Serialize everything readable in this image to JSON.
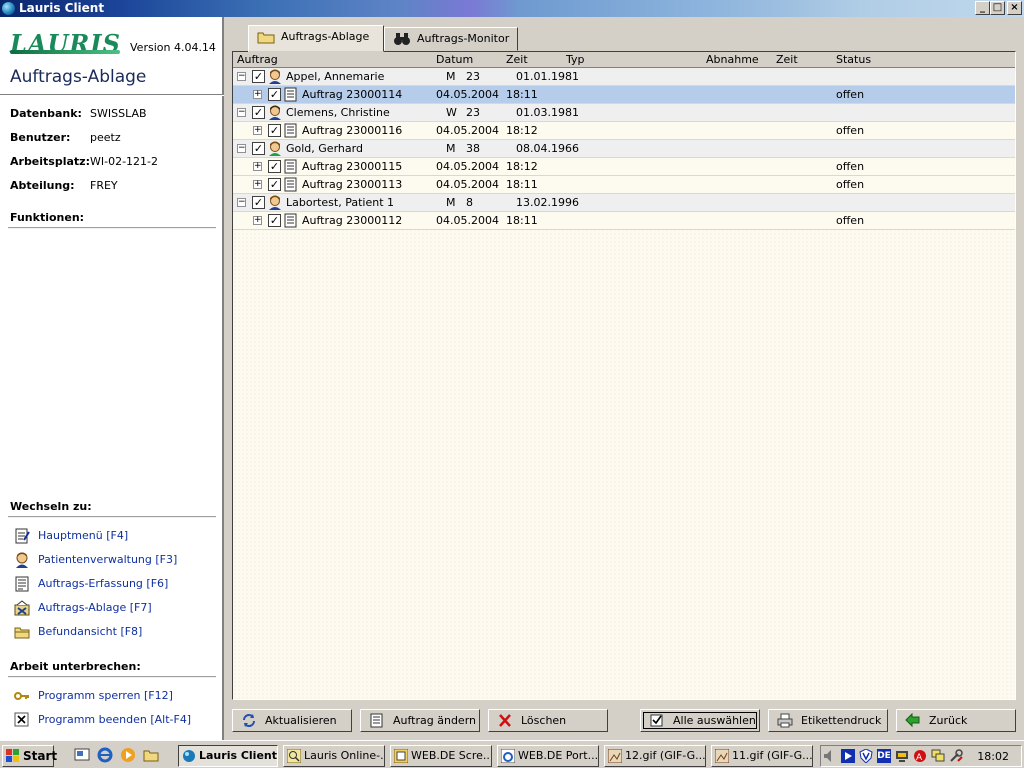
{
  "window": {
    "title": "Lauris Client",
    "controls": [
      "_",
      "□",
      "×"
    ]
  },
  "left": {
    "logo": "LAURIS",
    "version": "Version 4.04.14",
    "heading": "Auftrags-Ablage",
    "info": [
      {
        "key": "Datenbank:",
        "value": "SWISSLAB"
      },
      {
        "key": "Benutzer:",
        "value": "peetz"
      },
      {
        "key": "Arbeitsplatz:",
        "value": "WI-02-121-2"
      },
      {
        "key": "Abteilung:",
        "value": "FREY"
      }
    ],
    "functions_heading": "Funktionen:",
    "switch_heading": "Wechseln zu:",
    "switch_links": [
      {
        "label": "Hauptmenü [F4]",
        "icon": "menu-icon"
      },
      {
        "label": "Patientenverwaltung [F3]",
        "icon": "patient-icon"
      },
      {
        "label": "Auftrags-Erfassung [F6]",
        "icon": "order-entry-icon"
      },
      {
        "label": "Auftrags-Ablage [F7]",
        "icon": "order-archive-icon"
      },
      {
        "label": "Befundansicht [F8]",
        "icon": "folder-icon"
      }
    ],
    "interrupt_heading": "Arbeit unterbrechen:",
    "interrupt_links": [
      {
        "label": "Programm sperren [F12]",
        "icon": "key-icon"
      },
      {
        "label": "Programm beenden [Alt-F4]",
        "icon": "close-icon"
      }
    ]
  },
  "tabs": [
    {
      "label": "Auftrags-Ablage",
      "icon": "folder-icon",
      "active": true
    },
    {
      "label": "Auftrags-Monitor",
      "icon": "binoculars-icon",
      "active": false
    }
  ],
  "grid": {
    "columns": [
      "Auftrag",
      "Datum",
      "Zeit",
      "Typ",
      "Abnahme",
      "Zeit",
      "Status"
    ],
    "rows": [
      {
        "kind": "patient",
        "name": "Appel,  Annemarie",
        "sex": "M",
        "age": "23",
        "birth": "01.01.1981"
      },
      {
        "kind": "order",
        "name": "Auftrag 23000114",
        "date": "04.05.2004",
        "time": "18:11",
        "status": "offen",
        "selected": true
      },
      {
        "kind": "patient",
        "name": "Clemens,  Christine",
        "sex": "W",
        "age": "23",
        "birth": "01.03.1981"
      },
      {
        "kind": "order",
        "name": "Auftrag 23000116",
        "date": "04.05.2004",
        "time": "18:12",
        "status": "offen"
      },
      {
        "kind": "patient",
        "name": "Gold,  Gerhard",
        "sex": "M",
        "age": "38",
        "birth": "08.04.1966"
      },
      {
        "kind": "order",
        "name": "Auftrag 23000115",
        "date": "04.05.2004",
        "time": "18:12",
        "status": "offen"
      },
      {
        "kind": "order",
        "name": "Auftrag 23000113",
        "date": "04.05.2004",
        "time": "18:11",
        "status": "offen"
      },
      {
        "kind": "patient",
        "name": "Labortest,  Patient 1",
        "sex": "M",
        "age": "8",
        "birth": "13.02.1996"
      },
      {
        "kind": "order",
        "name": "Auftrag 23000112",
        "date": "04.05.2004",
        "time": "18:11",
        "status": "offen"
      }
    ]
  },
  "buttons": {
    "refresh": "Aktualisieren",
    "edit": "Auftrag ändern",
    "delete": "Löschen",
    "select_all": "Alle auswählen",
    "print_labels": "Etikettendruck",
    "back": "Zurück"
  },
  "taskbar": {
    "start": "Start",
    "items": [
      "Lauris Client",
      "Lauris Online-...",
      "WEB.DE Scre...",
      "WEB.DE Port...",
      "12.gif (GIF-G...",
      "11.gif (GIF-G..."
    ],
    "tray_lang": "DE",
    "clock": "18:02"
  },
  "colors": {
    "selection": "#b5cdea",
    "link": "#1030a0",
    "title_start": "#0a246a"
  }
}
